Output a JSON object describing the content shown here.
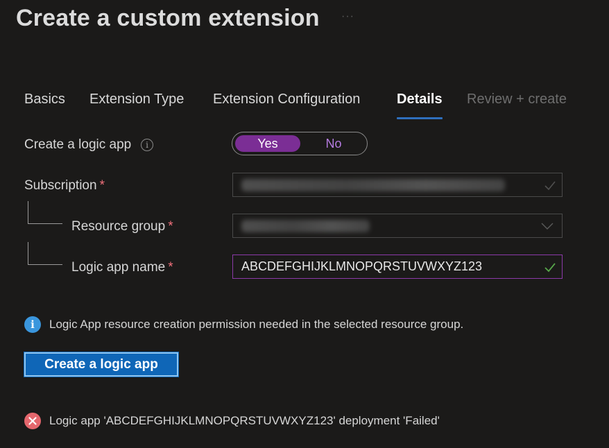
{
  "page": {
    "title": "Create a custom extension",
    "more_icon": "ellipsis-icon"
  },
  "tabs": [
    {
      "label": "Basics",
      "state": "normal"
    },
    {
      "label": "Extension Type",
      "state": "normal"
    },
    {
      "label": "Extension Configuration",
      "state": "normal"
    },
    {
      "label": "Details",
      "state": "active"
    },
    {
      "label": "Review + create",
      "state": "disabled"
    }
  ],
  "form": {
    "create_logic_app": {
      "label": "Create a logic app",
      "info_icon": "info-icon",
      "options": [
        "Yes",
        "No"
      ],
      "selected": "Yes"
    },
    "subscription": {
      "label": "Subscription",
      "required_mark": "*",
      "value_obscured": true
    },
    "resource_group": {
      "label": "Resource group",
      "required_mark": "*",
      "value_obscured": true
    },
    "logic_app_name": {
      "label": "Logic app name",
      "required_mark": "*",
      "value": "ABCDEFGHIJKLMNOPQRSTUVWXYZ123"
    }
  },
  "info_message": {
    "icon": "info-icon",
    "text": "Logic App resource creation permission needed in the selected resource group."
  },
  "create_button": {
    "label": "Create a logic app"
  },
  "error_message": {
    "icon": "error-icon",
    "text": "Logic app 'ABCDEFGHIJKLMNOPQRSTUVWXYZ123' deployment 'Failed'"
  },
  "colors": {
    "background": "#1b1a19",
    "accent_purple": "#7b2e95",
    "accent_blue": "#0f66b7",
    "tab_underline": "#2f6fbd",
    "required": "#f1707b",
    "success_check": "#57a64a",
    "error": "#e5676d",
    "info": "#3a96dd"
  }
}
